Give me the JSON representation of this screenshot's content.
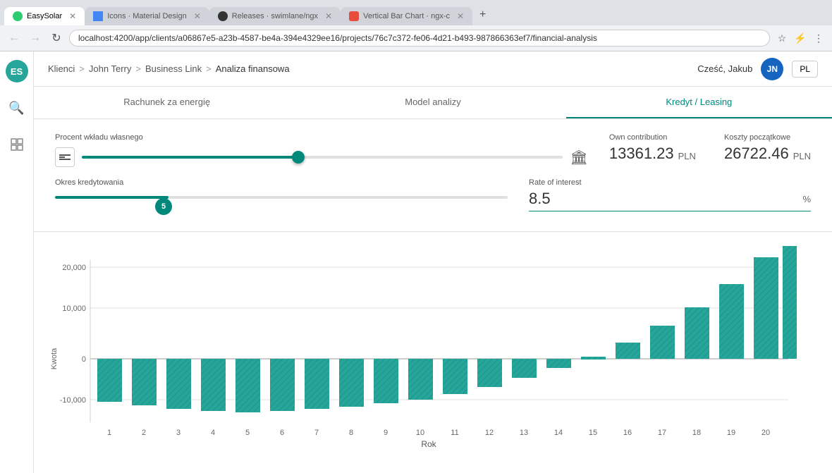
{
  "browser": {
    "tabs": [
      {
        "id": "easysolar",
        "label": "EasySolar",
        "favicon_type": "es",
        "active": true
      },
      {
        "id": "icons",
        "label": "Icons · Material Design",
        "favicon_type": "icons",
        "active": false
      },
      {
        "id": "swimlane",
        "label": "Releases · swimlane/ngx",
        "favicon_type": "github",
        "active": false
      },
      {
        "id": "ngxchart",
        "label": "Vertical Bar Chart · ngx-c",
        "favicon_type": "ngx",
        "active": false
      }
    ],
    "url": "localhost:4200/app/clients/a06867e5-a23b-4587-be4a-394e4329ee16/projects/76c7c372-fe06-4d21-b493-987866363ef7/financial-analysis"
  },
  "header": {
    "breadcrumb": {
      "items": [
        "Klienci",
        "John Terry",
        "Business Link"
      ],
      "current": "Analiza finansowa",
      "separators": [
        ">",
        ">",
        ">"
      ]
    },
    "greeting": "Cześć, Jakub",
    "user_initials": "JN",
    "lang": "PL"
  },
  "sidebar": {
    "avatar_initials": "ES",
    "items": [
      {
        "name": "search",
        "icon": "🔍"
      },
      {
        "name": "grid",
        "icon": "⊞"
      }
    ]
  },
  "tabs": [
    {
      "id": "rachunek",
      "label": "Rachunek za energię",
      "active": false
    },
    {
      "id": "model",
      "label": "Model analizy",
      "active": false
    },
    {
      "id": "kredyt",
      "label": "Kredyt / Leasing",
      "active": true
    }
  ],
  "panel": {
    "procent_label": "Procent wkładu własnego",
    "slider_value": 45,
    "own_contribution_label": "Own contribution",
    "own_contribution_value": "13361.23",
    "own_contribution_currency": "PLN",
    "koszty_label": "Koszty początkowe",
    "koszty_value": "26722.46",
    "koszty_currency": "PLN",
    "okres_label": "Okres kredytowania",
    "okres_value": "5",
    "rate_label": "Rate of interest",
    "rate_value": "8.5",
    "rate_unit": "%"
  },
  "chart": {
    "y_axis_label": "Kwota",
    "x_axis_label": "Rok",
    "y_ticks": [
      "20,000",
      "10,000",
      "0",
      "-10,000"
    ],
    "x_ticks": [
      "1",
      "2",
      "3",
      "4",
      "5",
      "6",
      "7",
      "8",
      "9",
      "10",
      "11",
      "12",
      "13",
      "14",
      "15",
      "16",
      "17",
      "18",
      "19",
      "20"
    ],
    "bars": [
      {
        "year": 1,
        "value": -8500
      },
      {
        "year": 2,
        "value": -9200
      },
      {
        "year": 3,
        "value": -9800
      },
      {
        "year": 4,
        "value": -10200
      },
      {
        "year": 5,
        "value": -10500
      },
      {
        "year": 6,
        "value": -10200
      },
      {
        "year": 7,
        "value": -9900
      },
      {
        "year": 8,
        "value": -9400
      },
      {
        "year": 9,
        "value": -8800
      },
      {
        "year": 10,
        "value": -8000
      },
      {
        "year": 11,
        "value": -6900
      },
      {
        "year": 12,
        "value": -5500
      },
      {
        "year": 13,
        "value": -3800
      },
      {
        "year": 14,
        "value": -1800
      },
      {
        "year": 15,
        "value": 500
      },
      {
        "year": 16,
        "value": 3200
      },
      {
        "year": 17,
        "value": 6500
      },
      {
        "year": 18,
        "value": 10200
      },
      {
        "year": 19,
        "value": 14800
      },
      {
        "year": 20,
        "value": 20000
      },
      {
        "year": 20.5,
        "value": 22000
      }
    ]
  }
}
